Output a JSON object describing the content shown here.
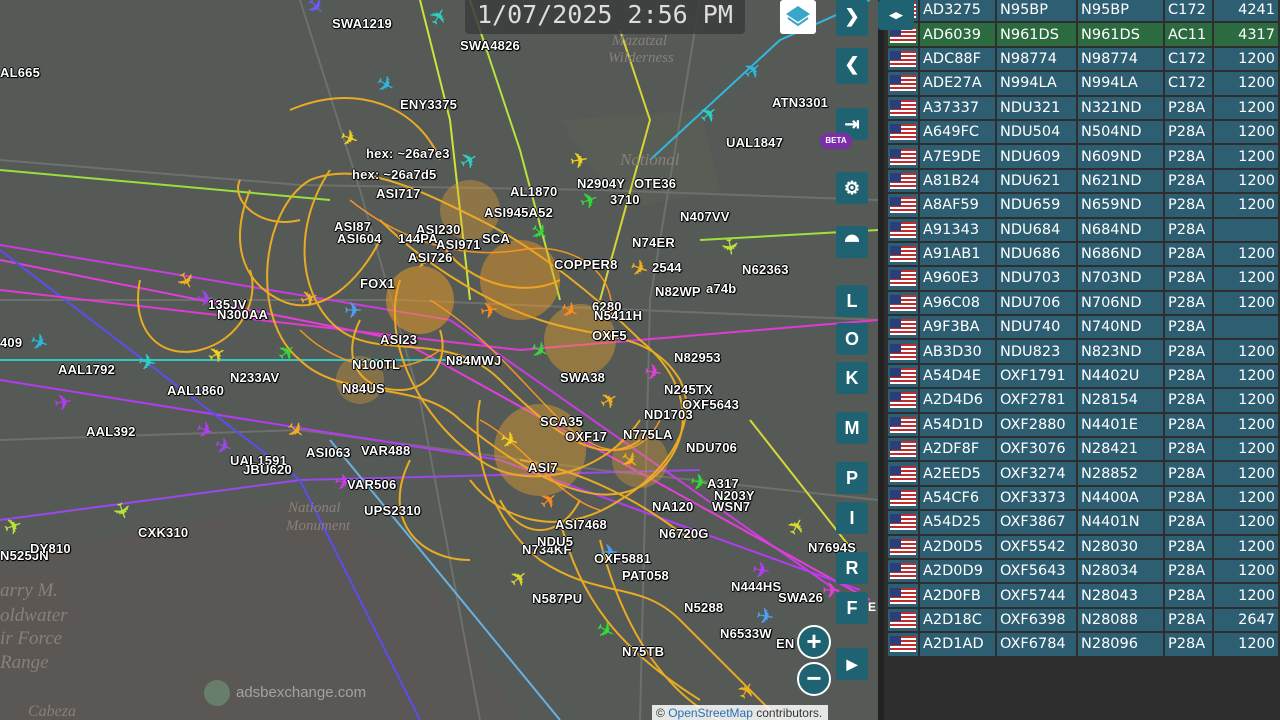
{
  "timestamp": "1/07/2025 2:56 PM",
  "map": {
    "place_labels": [
      "Mazatzal",
      "Wilderness",
      "National",
      "National",
      "Monument",
      "arry M.",
      "oldwater",
      "ir Force",
      "Range",
      "Cabeza"
    ],
    "watermark": "adsbexchange.com",
    "attribution": {
      "prefix": "© ",
      "link": "OpenStreetMap",
      "suffix": " contributors."
    },
    "beta_badge": "BETA",
    "flight_labels": [
      "SWA1219",
      "SWA4826",
      "AL665",
      "ENY3375",
      "ATN3301",
      "UAL1847",
      "hex: ~26a7e3",
      "hex: ~26a7d5",
      "ASI717",
      "AL1870",
      "N2904Y",
      "OTE36",
      "ASI945A52",
      "3710",
      "ASI87",
      "ASI230",
      "N407VV",
      "ASI604",
      "144PA",
      "ASI971",
      "SCA",
      "ASI726",
      "N74ER",
      "COPPER8",
      "N62363",
      "FOX1",
      "2544",
      "N82WP",
      "a74b",
      "135JV",
      "N300AA",
      "6280",
      "N5411H",
      "409",
      "OXF5",
      "AAL1792",
      "N82953",
      "ASI23",
      "N84MWJ",
      "AAL1860",
      "N233AV",
      "N100TL",
      "N84US",
      "SWA38",
      "N245TX",
      "OXF5643",
      "AAL392",
      "ND1703",
      "ASI063",
      "VAR488",
      "SCA35",
      "OXF17",
      "N775LA",
      "NDU706",
      "UAL1591",
      "JBU620",
      "VAR506",
      "ASI7",
      "A317",
      "UPS2310",
      "N203Y",
      "CXK310",
      "NA120",
      "WSN7",
      "N525JN",
      "ASI7468",
      "N7694S",
      "DY810",
      "N734KF",
      "N6720G",
      "NDU5",
      "OXF5881",
      "PAT058",
      "N444HS",
      "N587PU",
      "N5288",
      "SWA26",
      "N6533W",
      "N75TB",
      "EN"
    ]
  },
  "controls": {
    "next": "❯",
    "prev": "❮",
    "login": "⇥",
    "settings": "⚙",
    "filter": "⯊",
    "letters": [
      "L",
      "O",
      "K",
      "M",
      "P",
      "I",
      "R",
      "F"
    ],
    "zoom_in": "+",
    "zoom_out": "−",
    "replay": "▶",
    "toggle": "◂▸",
    "edge": "E"
  },
  "table": {
    "rows": [
      {
        "hex": "AD3275",
        "callsign": "N95BP",
        "reg": "N95BP",
        "type": "C172",
        "squawk": "4241",
        "selected": false
      },
      {
        "hex": "AD6039",
        "callsign": "N961DS",
        "reg": "N961DS",
        "type": "AC11",
        "squawk": "4317",
        "selected": true
      },
      {
        "hex": "ADC88F",
        "callsign": "N98774",
        "reg": "N98774",
        "type": "C172",
        "squawk": "1200",
        "selected": false
      },
      {
        "hex": "ADE27A",
        "callsign": "N994LA",
        "reg": "N994LA",
        "type": "C172",
        "squawk": "1200",
        "selected": false
      },
      {
        "hex": "A37337",
        "callsign": "NDU321",
        "reg": "N321ND",
        "type": "P28A",
        "squawk": "1200",
        "selected": false
      },
      {
        "hex": "A649FC",
        "callsign": "NDU504",
        "reg": "N504ND",
        "type": "P28A",
        "squawk": "1200",
        "selected": false
      },
      {
        "hex": "A7E9DE",
        "callsign": "NDU609",
        "reg": "N609ND",
        "type": "P28A",
        "squawk": "1200",
        "selected": false
      },
      {
        "hex": "A81B24",
        "callsign": "NDU621",
        "reg": "N621ND",
        "type": "P28A",
        "squawk": "1200",
        "selected": false
      },
      {
        "hex": "A8AF59",
        "callsign": "NDU659",
        "reg": "N659ND",
        "type": "P28A",
        "squawk": "1200",
        "selected": false
      },
      {
        "hex": "A91343",
        "callsign": "NDU684",
        "reg": "N684ND",
        "type": "P28A",
        "squawk": "",
        "selected": false
      },
      {
        "hex": "A91AB1",
        "callsign": "NDU686",
        "reg": "N686ND",
        "type": "P28A",
        "squawk": "1200",
        "selected": false
      },
      {
        "hex": "A960E3",
        "callsign": "NDU703",
        "reg": "N703ND",
        "type": "P28A",
        "squawk": "1200",
        "selected": false
      },
      {
        "hex": "A96C08",
        "callsign": "NDU706",
        "reg": "N706ND",
        "type": "P28A",
        "squawk": "1200",
        "selected": false
      },
      {
        "hex": "A9F3BA",
        "callsign": "NDU740",
        "reg": "N740ND",
        "type": "P28A",
        "squawk": "",
        "selected": false
      },
      {
        "hex": "AB3D30",
        "callsign": "NDU823",
        "reg": "N823ND",
        "type": "P28A",
        "squawk": "1200",
        "selected": false
      },
      {
        "hex": "A54D4E",
        "callsign": "OXF1791",
        "reg": "N4402U",
        "type": "P28A",
        "squawk": "1200",
        "selected": false
      },
      {
        "hex": "A2D4D6",
        "callsign": "OXF2781",
        "reg": "N28154",
        "type": "P28A",
        "squawk": "1200",
        "selected": false
      },
      {
        "hex": "A54D1D",
        "callsign": "OXF2880",
        "reg": "N4401E",
        "type": "P28A",
        "squawk": "1200",
        "selected": false
      },
      {
        "hex": "A2DF8F",
        "callsign": "OXF3076",
        "reg": "N28421",
        "type": "P28A",
        "squawk": "1200",
        "selected": false
      },
      {
        "hex": "A2EED5",
        "callsign": "OXF3274",
        "reg": "N28852",
        "type": "P28A",
        "squawk": "1200",
        "selected": false
      },
      {
        "hex": "A54CF6",
        "callsign": "OXF3373",
        "reg": "N4400A",
        "type": "P28A",
        "squawk": "1200",
        "selected": false
      },
      {
        "hex": "A54D25",
        "callsign": "OXF3867",
        "reg": "N4401N",
        "type": "P28A",
        "squawk": "1200",
        "selected": false
      },
      {
        "hex": "A2D0D5",
        "callsign": "OXF5542",
        "reg": "N28030",
        "type": "P28A",
        "squawk": "1200",
        "selected": false
      },
      {
        "hex": "A2D0D9",
        "callsign": "OXF5643",
        "reg": "N28034",
        "type": "P28A",
        "squawk": "1200",
        "selected": false
      },
      {
        "hex": "A2D0FB",
        "callsign": "OXF5744",
        "reg": "N28043",
        "type": "P28A",
        "squawk": "1200",
        "selected": false
      },
      {
        "hex": "A2D18C",
        "callsign": "OXF6398",
        "reg": "N28088",
        "type": "P28A",
        "squawk": "2647",
        "selected": false
      },
      {
        "hex": "A2D1AD",
        "callsign": "OXF6784",
        "reg": "N28096",
        "type": "P28A",
        "squawk": "1200",
        "selected": false
      }
    ]
  }
}
